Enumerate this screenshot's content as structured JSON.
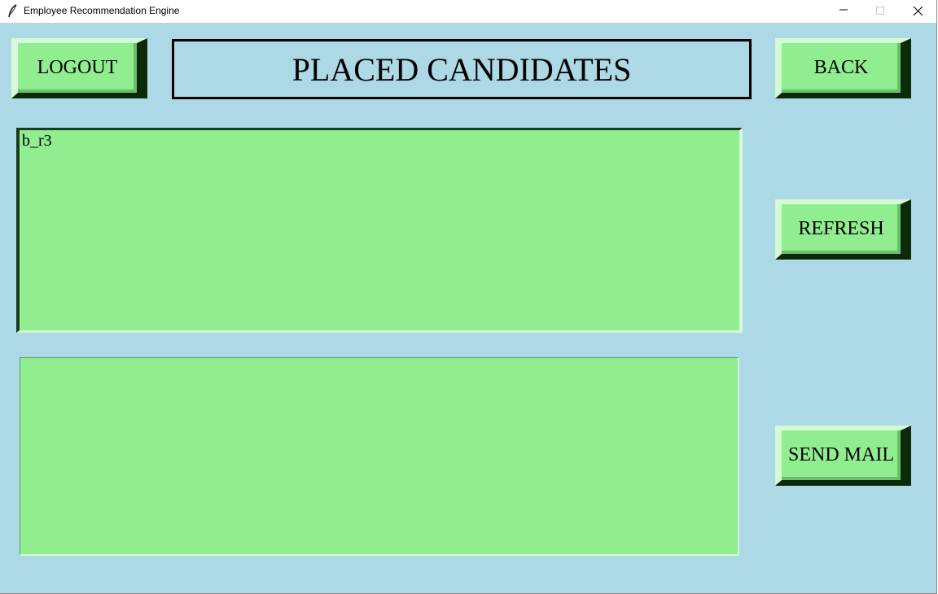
{
  "window": {
    "title": "Employee Recommendation Engine",
    "controls": {
      "minimize_icon": "minimize-icon",
      "maximize_icon": "maximize-icon",
      "close_icon": "close-icon"
    }
  },
  "header": {
    "title": "PLACED CANDIDATES",
    "logout_label": "LOGOUT",
    "back_label": "BACK"
  },
  "side": {
    "refresh_label": "REFRESH",
    "send_mail_label": "SEND MAIL"
  },
  "candidates_list": {
    "items": [
      "b_r3"
    ]
  },
  "colors": {
    "background": "#add8e6",
    "button_face": "#90ee90",
    "listbox": "#90ee90",
    "text": "#000000"
  }
}
